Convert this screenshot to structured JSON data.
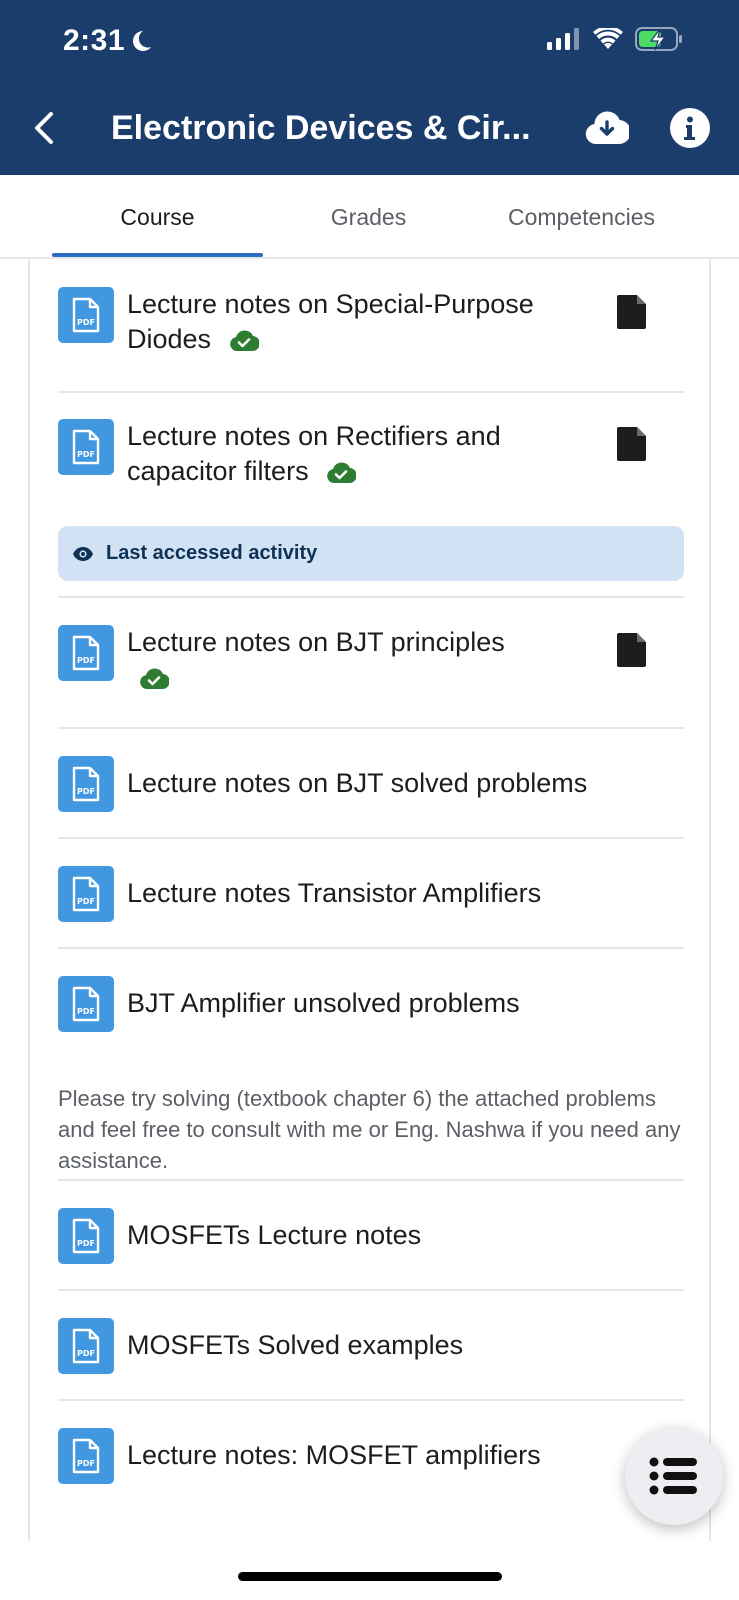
{
  "status": {
    "time": "2:31"
  },
  "header": {
    "title": "Electronic Devices & Cir..."
  },
  "tabs": [
    "Course",
    "Grades",
    "Competencies"
  ],
  "activities": [
    {
      "title": "Lecture notes on Special-Purpose Diodes",
      "line1": "Lecture notes on Special-Purpose",
      "line2": "Diodes",
      "downloaded": true
    },
    {
      "title": "Lecture notes on Rectifiers and capacitor filters",
      "line1": "Lecture notes on Rectifiers and",
      "line2": "capacitor filters",
      "downloaded": true
    },
    {
      "title": "Lecture notes on BJT principles",
      "line1": "Lecture notes on BJT principles",
      "downloaded": true
    },
    {
      "title": "Lecture notes on BJT solved problems"
    },
    {
      "title": "Lecture notes Transistor Amplifiers"
    },
    {
      "title": "BJT Amplifier unsolved problems",
      "description": "Please try solving (textbook chapter 6) the attached problems and feel free to consult with me or Eng. Nashwa if you need any assistance."
    },
    {
      "title": "MOSFETs Lecture notes"
    },
    {
      "title": "MOSFETs Solved examples"
    },
    {
      "title": "Lecture notes: MOSFET amplifiers"
    }
  ],
  "last_accessed": {
    "label": "Last accessed activity"
  },
  "icons": {
    "pdf_label": "PDF"
  },
  "colors": {
    "header": "#1b3d6b",
    "accent": "#2b6cc4",
    "pdf": "#4197e0",
    "success": "#2e7d32",
    "highlight": "#d0e2f3"
  }
}
